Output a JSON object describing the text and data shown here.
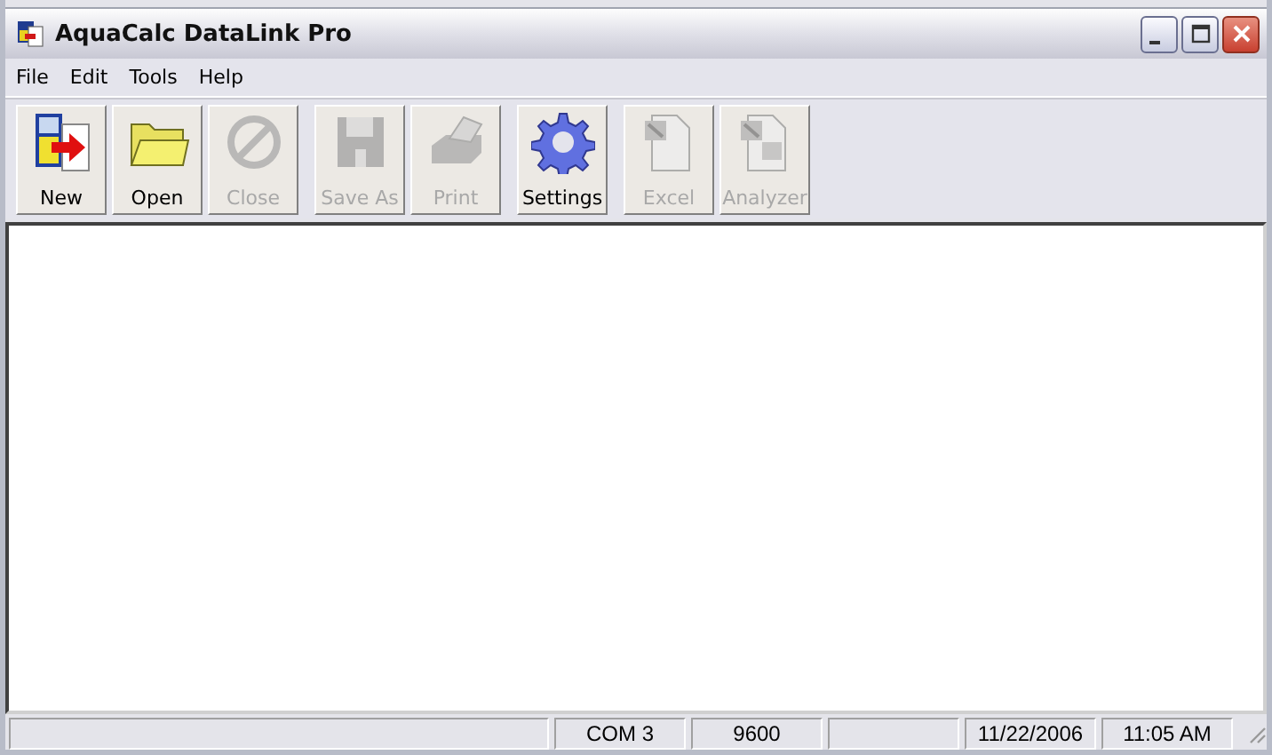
{
  "window": {
    "title": "AquaCalc DataLink Pro"
  },
  "menu": [
    "File",
    "Edit",
    "Tools",
    "Help"
  ],
  "toolbar_groups": [
    [
      {
        "kind": "new",
        "label": "New",
        "disabled": false
      },
      {
        "kind": "open",
        "label": "Open",
        "disabled": false
      },
      {
        "kind": "close",
        "label": "Close",
        "disabled": true
      }
    ],
    [
      {
        "kind": "save",
        "label": "Save As",
        "disabled": true
      },
      {
        "kind": "print",
        "label": "Print",
        "disabled": true
      }
    ],
    [
      {
        "kind": "settings",
        "label": "Settings",
        "disabled": false
      }
    ],
    [
      {
        "kind": "excel",
        "label": "Excel",
        "disabled": true
      },
      {
        "kind": "analyzer",
        "label": "Analyzer",
        "disabled": true
      }
    ]
  ],
  "status_bar": [
    {
      "kind": "wide"
    },
    {
      "kind": "panel",
      "text": "COM 3"
    },
    {
      "kind": "panel",
      "text": "9600"
    },
    {
      "kind": "panel"
    },
    {
      "kind": "panel",
      "text": "11/22/2006"
    },
    {
      "kind": "panel",
      "text": "11:05 AM"
    }
  ]
}
